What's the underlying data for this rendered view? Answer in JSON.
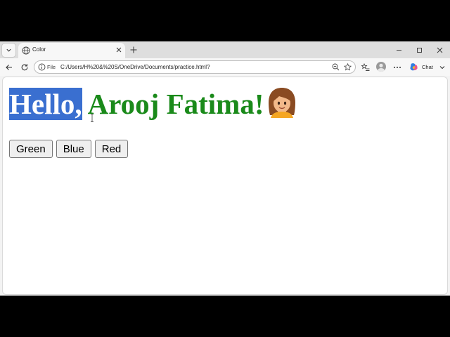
{
  "tab": {
    "title": "Color"
  },
  "address": {
    "scheme": "File",
    "url": "C:/Users/H%20&%20S/OneDrive/Documents/practice.html?"
  },
  "copilot": {
    "label": "Chat"
  },
  "page": {
    "heading_selected": "Hello,",
    "heading_rest": " Arooj Fatima!",
    "buttons": [
      "Green",
      "Blue",
      "Red"
    ]
  },
  "colors": {
    "heading_text": "#1a8a1a",
    "selection_bg": "#3a6fd0"
  },
  "icons": [
    "tab-actions-chevron-icon",
    "globe-icon",
    "close-icon",
    "plus-icon",
    "minimize-icon",
    "maximize-icon",
    "window-close-icon",
    "back-arrow-icon",
    "refresh-icon",
    "info-icon",
    "zoom-out-icon",
    "star-icon",
    "favorites-icon",
    "profile-icon",
    "more-icon",
    "copilot-icon",
    "chevron-down-icon",
    "woman-emoji-icon",
    "text-cursor-icon"
  ]
}
